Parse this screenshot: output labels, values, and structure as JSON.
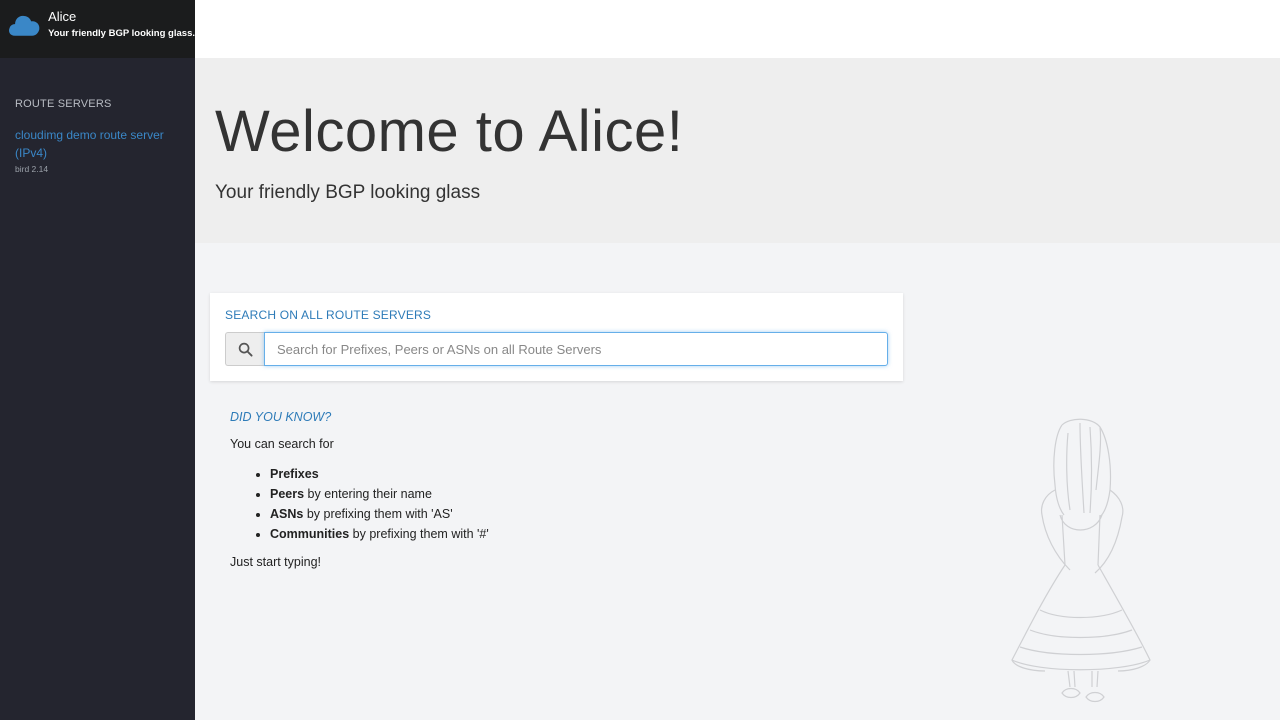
{
  "brand": {
    "title": "Alice",
    "subtitle": "Your friendly BGP looking glass.",
    "icon": "cloud-icon",
    "accent": "#3a87c7"
  },
  "sidebar": {
    "section_title": "ROUTE SERVERS",
    "servers": [
      {
        "name": "cloudimg demo route server (IPv4)",
        "version": "bird 2.14"
      }
    ]
  },
  "hero": {
    "title": "Welcome to Alice!",
    "subtitle": "Your friendly BGP looking glass"
  },
  "search": {
    "title": "SEARCH ON ALL ROUTE SERVERS",
    "placeholder": "Search for Prefixes, Peers or ASNs on all Route Servers",
    "value": "",
    "icon": "search-icon"
  },
  "did_you_know": {
    "heading": "DID YOU KNOW?",
    "intro": "You can search for",
    "items": [
      {
        "term": "Prefixes",
        "rest": ""
      },
      {
        "term": "Peers",
        "rest": " by entering their name"
      },
      {
        "term": "ASNs",
        "rest": " by prefixing them with 'AS'"
      },
      {
        "term": "Communities",
        "rest": " by prefixing them with '#'"
      }
    ],
    "outro": "Just start typing!"
  },
  "illustration": {
    "icon": "alice-illustration-icon"
  }
}
